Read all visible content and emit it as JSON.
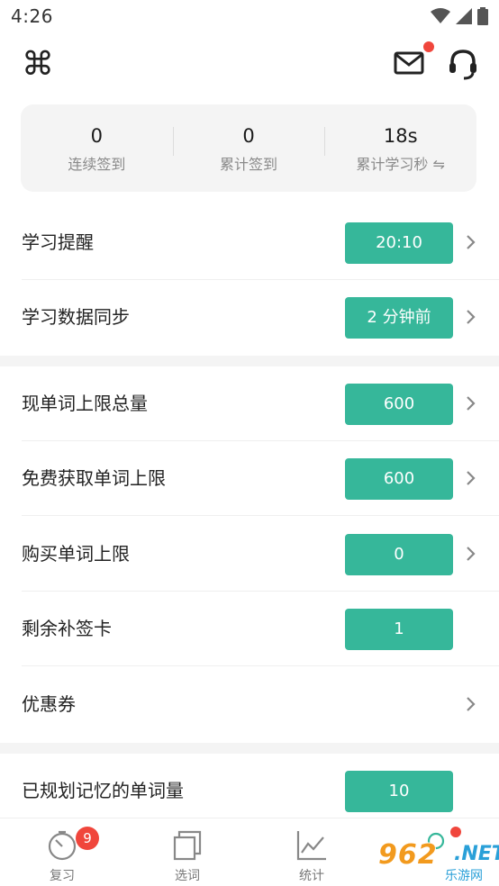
{
  "status_bar": {
    "time": "4:26"
  },
  "header": {
    "left_icon": "command-icon",
    "mail_icon": "mail-icon",
    "support_icon": "headset-icon"
  },
  "stats": [
    {
      "value": "0",
      "label": "连续签到"
    },
    {
      "value": "0",
      "label": "累计签到"
    },
    {
      "value": "18s",
      "label": "累计学习秒 ⇋"
    }
  ],
  "section1": [
    {
      "label": "学习提醒",
      "value": "20:10",
      "chevron": true
    },
    {
      "label": "学习数据同步",
      "value": "2 分钟前",
      "chevron": true
    }
  ],
  "section2": [
    {
      "label": "现单词上限总量",
      "value": "600",
      "chevron": true
    },
    {
      "label": "免费获取单词上限",
      "value": "600",
      "chevron": true
    },
    {
      "label": "购买单词上限",
      "value": "0",
      "chevron": true
    },
    {
      "label": "剩余补签卡",
      "value": "1",
      "chevron": false
    },
    {
      "label": "优惠券",
      "value": "",
      "chevron": true
    }
  ],
  "section3": [
    {
      "label": "已规划记忆的单词量",
      "value": "10",
      "chevron": false
    }
  ],
  "tabbar": {
    "tabs": [
      {
        "label": "复习",
        "icon": "timer-icon"
      },
      {
        "label": "选词",
        "icon": "cards-icon"
      },
      {
        "label": "统计",
        "icon": "chart-icon"
      },
      {
        "label": "",
        "icon": "profile-icon"
      }
    ],
    "review_badge": "9"
  },
  "watermark": {
    "logo": "962",
    "net": ".NET",
    "sub": "乐游网"
  },
  "colors": {
    "accent": "#36b79a",
    "badge": "#f0463c",
    "section_bg": "#f4f4f4"
  }
}
